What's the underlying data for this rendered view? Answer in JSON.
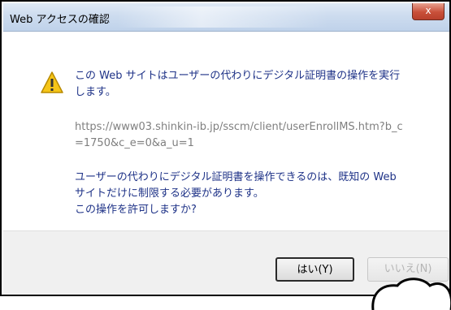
{
  "window": {
    "title": "Web アクセスの確認",
    "close_glyph": "x"
  },
  "message": {
    "line1": "この Web サイトはユーザーの代わりにデジタル証明書の操作を実行",
    "line2": "します。",
    "url_line1": "https://www03.shinkin-ib.jp/sscm/client/userEnrollMS.htm?b_c",
    "url_line2": "=1750&c_e=0&a_u=1",
    "line3": "ユーザーの代わりにデジタル証明書を操作できるのは、既知の Web",
    "line4": "サイトだけに制限する必要があります。",
    "line5": "この操作を許可しますか?"
  },
  "buttons": {
    "yes_label": "はい(Y)",
    "no_label": "いいえ(N)"
  },
  "icons": {
    "warning": "warning-icon"
  },
  "colors": {
    "message_text": "#1e3287",
    "url_text": "#7f7f7f",
    "close_button": "#c9503a"
  }
}
